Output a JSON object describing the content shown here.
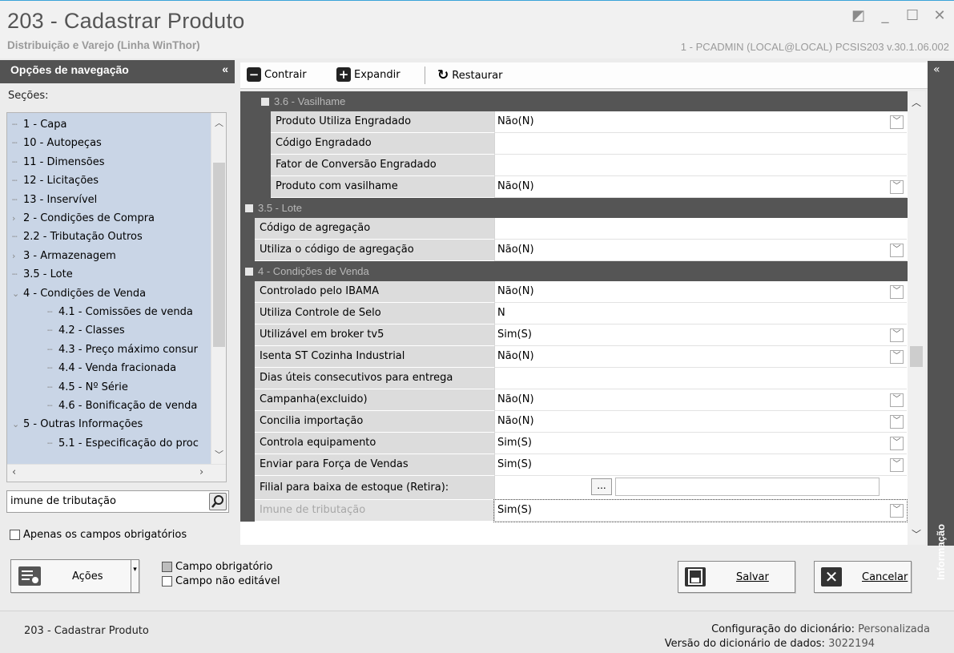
{
  "window": {
    "title": "203 - Cadastrar  Produto",
    "subtitle": "Distribuição e Varejo (Linha WinThor)",
    "info": "1 - PCADMIN (LOCAL@LOCAL)  PCSIS203  v.30.1.06.002",
    "controls": [
      "restore-down",
      "minimize",
      "maximize",
      "close"
    ]
  },
  "nav": {
    "header": "Opções de navegação",
    "collapse_glyph": "«",
    "sections_label": "Seções:",
    "tree": [
      {
        "label": "1 - Capa",
        "level": 1,
        "expander": ""
      },
      {
        "label": "10 - Autopeças",
        "level": 1,
        "expander": ""
      },
      {
        "label": "11 - Dimensões",
        "level": 1,
        "expander": ""
      },
      {
        "label": "12 - Licitações",
        "level": 1,
        "expander": ""
      },
      {
        "label": "13 - Inservível",
        "level": 1,
        "expander": ""
      },
      {
        "label": "2 - Condições de Compra",
        "level": 1,
        "expander": "›"
      },
      {
        "label": "2.2 - Tributação Outros",
        "level": 1,
        "expander": ""
      },
      {
        "label": "3 - Armazenagem",
        "level": 1,
        "expander": "›"
      },
      {
        "label": "3.5 - Lote",
        "level": 1,
        "expander": ""
      },
      {
        "label": "4 - Condições de Venda",
        "level": 1,
        "expander": "⌄"
      },
      {
        "label": "4.1 - Comissões de venda",
        "level": 2,
        "expander": ""
      },
      {
        "label": "4.2 - Classes",
        "level": 2,
        "expander": ""
      },
      {
        "label": "4.3 - Preço máximo consur",
        "level": 2,
        "expander": ""
      },
      {
        "label": "4.4 - Venda fracionada",
        "level": 2,
        "expander": ""
      },
      {
        "label": "4.5 - Nº Série",
        "level": 2,
        "expander": ""
      },
      {
        "label": "4.6 - Bonificação de venda",
        "level": 2,
        "expander": ""
      },
      {
        "label": "5 - Outras Informações",
        "level": 1,
        "expander": "⌄"
      },
      {
        "label": "5.1 - Especificação do proc",
        "level": 2,
        "expander": ""
      }
    ],
    "search_value": "imune de tributação",
    "required_only_label": "Apenas os campos obrigatórios"
  },
  "toolbar": {
    "collapse_label": "Contrair",
    "expand_label": "Expandir",
    "restore_label": "Restaurar"
  },
  "grid": {
    "rows": [
      {
        "kind": "category",
        "label": "3.6 - Vasilhame",
        "indent": 1
      },
      {
        "kind": "prop",
        "name": "Produto Utiliza Engradado",
        "value": "Não(N)",
        "dropdown": true,
        "indent": 1
      },
      {
        "kind": "prop",
        "name": "Código Engradado",
        "value": "",
        "dropdown": false,
        "indent": 1
      },
      {
        "kind": "prop",
        "name": "Fator de Conversão Engradado",
        "value": "",
        "dropdown": false,
        "indent": 1
      },
      {
        "kind": "prop",
        "name": "Produto com vasilhame",
        "value": "Não(N)",
        "dropdown": true,
        "indent": 1
      },
      {
        "kind": "category",
        "label": "3.5 - Lote",
        "indent": 0
      },
      {
        "kind": "prop",
        "name": "Código de agregação",
        "value": "",
        "dropdown": false,
        "indent": 0
      },
      {
        "kind": "prop",
        "name": "Utiliza o código de agregação",
        "value": "Não(N)",
        "dropdown": true,
        "indent": 0
      },
      {
        "kind": "category",
        "label": "4 - Condições de Venda",
        "indent": 0
      },
      {
        "kind": "prop",
        "name": "Controlado pelo IBAMA",
        "value": "Não(N)",
        "dropdown": true,
        "indent": 0
      },
      {
        "kind": "prop",
        "name": "Utiliza Controle de Selo",
        "value": "N",
        "dropdown": false,
        "indent": 0
      },
      {
        "kind": "prop",
        "name": "Utilizável em broker tv5",
        "value": "Sim(S)",
        "dropdown": true,
        "indent": 0
      },
      {
        "kind": "prop",
        "name": "Isenta ST Cozinha Industrial",
        "value": "Não(N)",
        "dropdown": true,
        "indent": 0
      },
      {
        "kind": "prop",
        "name": "Dias úteis consecutivos para entrega",
        "value": "",
        "dropdown": false,
        "indent": 0
      },
      {
        "kind": "prop",
        "name": "Campanha(excluido)",
        "value": "Não(N)",
        "dropdown": true,
        "indent": 0
      },
      {
        "kind": "prop",
        "name": "Concilia importação",
        "value": "Não(N)",
        "dropdown": true,
        "indent": 0
      },
      {
        "kind": "prop",
        "name": "Controla equipamento",
        "value": "Sim(S)",
        "dropdown": true,
        "indent": 0
      },
      {
        "kind": "prop",
        "name": "Enviar para Força de Vendas",
        "value": "Sim(S)",
        "dropdown": true,
        "indent": 0
      },
      {
        "kind": "filial",
        "name": "Filial para baixa de estoque (Retira):",
        "button": "...",
        "indent": 0
      },
      {
        "kind": "prop",
        "name": "Imune de tributação",
        "value": "Sim(S)",
        "dropdown": true,
        "indent": 0,
        "disabled": true
      }
    ]
  },
  "info_panel": {
    "label": "Informação",
    "collapse_glyph": "«"
  },
  "bottom": {
    "actions_label": "Ações",
    "legend_required": "Campo obrigatório",
    "legend_readonly": "Campo não editável",
    "save_label": "Salvar",
    "cancel_label": "Cancelar"
  },
  "status": {
    "left": "203 - Cadastrar  Produto",
    "dict_config_label": "Configuração do dicionário:",
    "dict_config_value": "Personalizada",
    "dict_version_label": "Versão do dicionário de dados:",
    "dict_version_value": "3022194"
  },
  "colors": {
    "accent": "#3aa4d9",
    "nav_header": "#535353",
    "tree_selection": "#c9d5e6",
    "category_bar": "#555555"
  }
}
